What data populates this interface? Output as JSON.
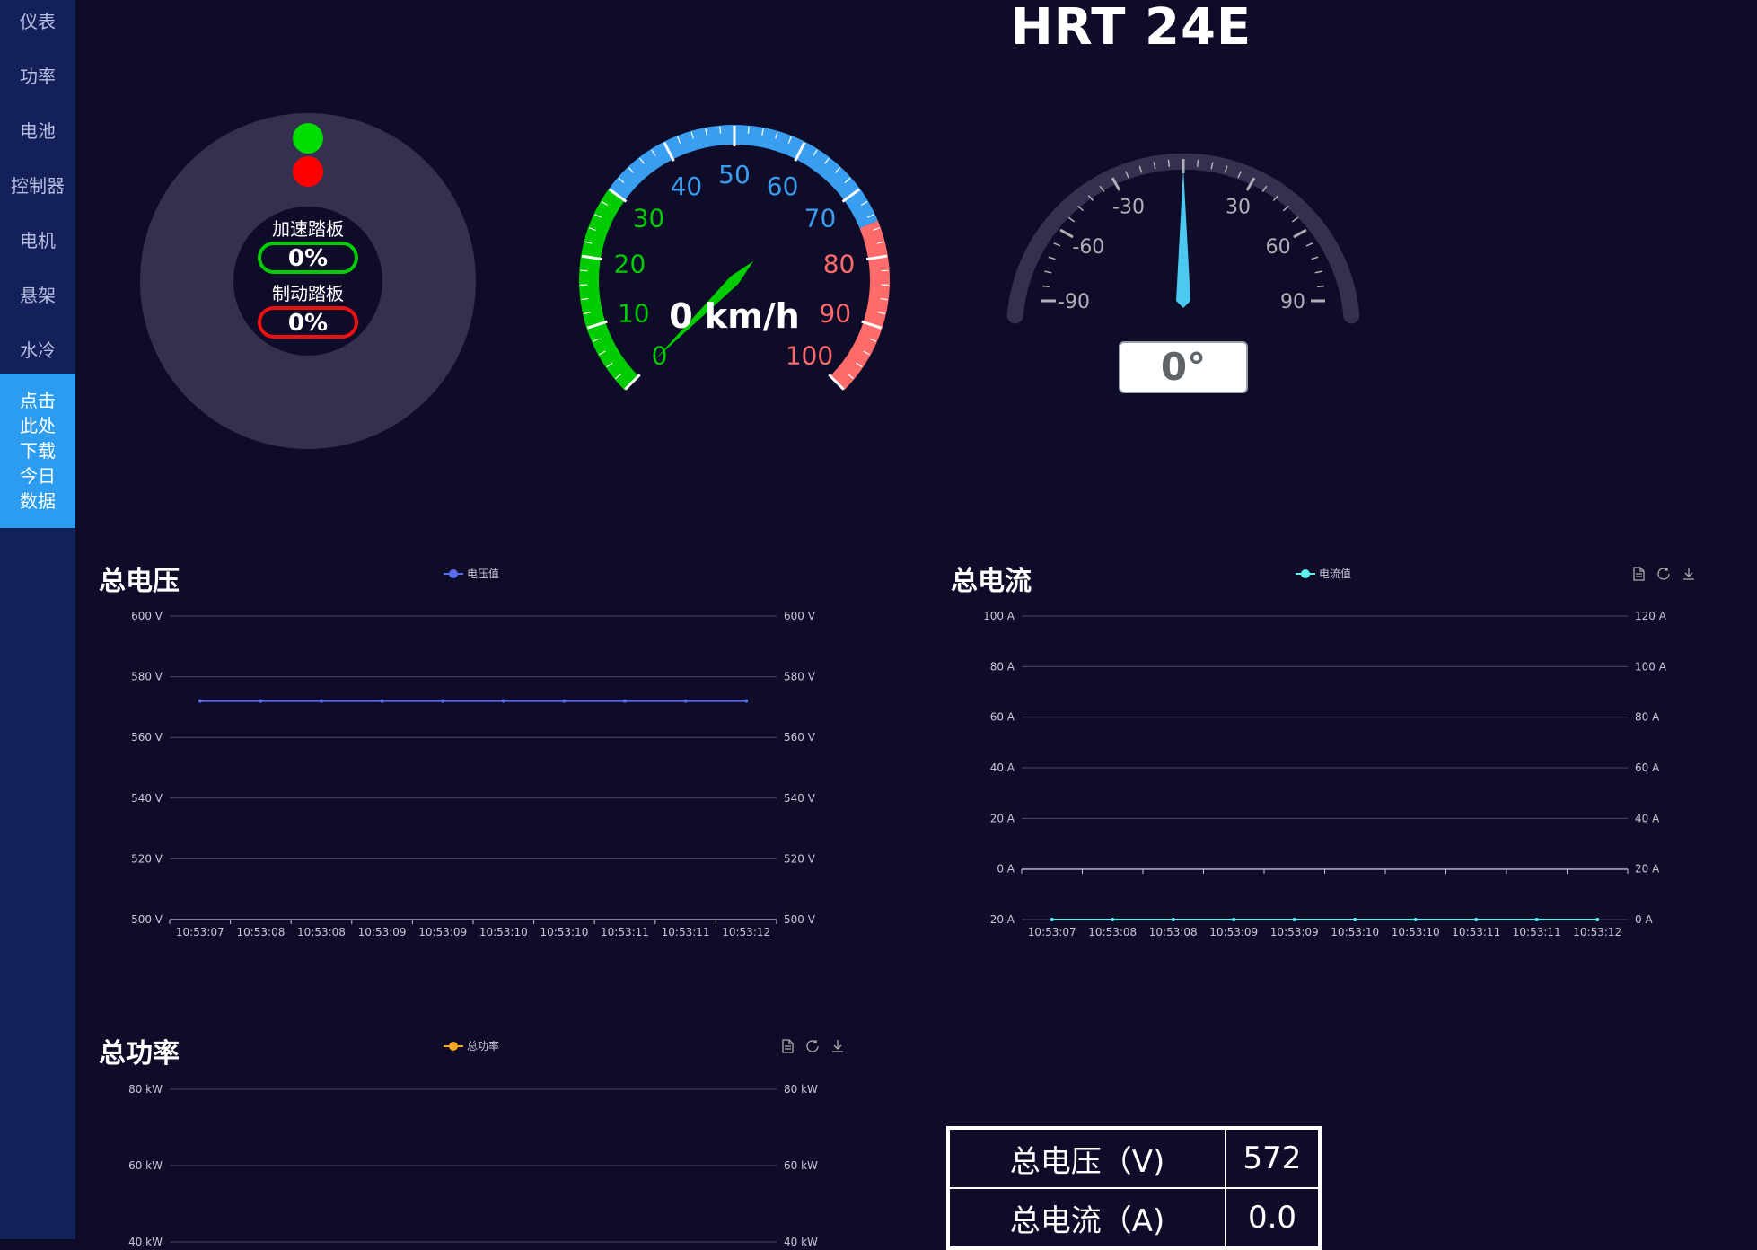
{
  "app_title": "HRT 24E",
  "sidebar": {
    "items": [
      {
        "label": "仪表"
      },
      {
        "label": "功率"
      },
      {
        "label": "电池"
      },
      {
        "label": "控制器"
      },
      {
        "label": "电机"
      },
      {
        "label": "悬架"
      },
      {
        "label": "水冷"
      }
    ],
    "download_lines": [
      "点击",
      "此处",
      "下载",
      "今日",
      "数据"
    ]
  },
  "pedals": {
    "accel_label": "加速踏板",
    "accel_value": "0%",
    "brake_label": "制动踏板",
    "brake_value": "0%",
    "accel_color": "#00cc00",
    "brake_color": "#ee1111"
  },
  "speedometer": {
    "value": 0,
    "unit": "km/h",
    "display": "0 km/h",
    "ticks": [
      "0",
      "10",
      "20",
      "30",
      "40",
      "50",
      "60",
      "70",
      "80",
      "90",
      "100"
    ],
    "zones": [
      {
        "from": 0,
        "to": 30,
        "color": "#00cc00"
      },
      {
        "from": 30,
        "to": 75,
        "color": "#3a9ef0"
      },
      {
        "from": 75,
        "to": 100,
        "color": "#ff6b6b"
      }
    ]
  },
  "steering": {
    "value_deg": 0,
    "display": "0°",
    "ticks": [
      "-90",
      "-60",
      "-30",
      "30",
      "60",
      "90"
    ]
  },
  "chart_data": [
    {
      "title": "总电压",
      "type": "line",
      "legend": "电压值",
      "color": "#5b6bee",
      "x": [
        "10:53:07",
        "10:53:08",
        "10:53:08",
        "10:53:09",
        "10:53:09",
        "10:53:10",
        "10:53:10",
        "10:53:11",
        "10:53:11",
        "10:53:12"
      ],
      "y": [
        572,
        572,
        572,
        572,
        572,
        572,
        572,
        572,
        572,
        572
      ],
      "ylim": [
        500,
        600
      ],
      "yticks": [
        "600 V",
        "580 V",
        "560 V",
        "540 V",
        "520 V",
        "500 V"
      ],
      "ylim_right": [
        500,
        600
      ],
      "yticks_right": [
        "600 V",
        "580 V",
        "560 V",
        "540 V",
        "520 V",
        "500 V"
      ],
      "grid": true
    },
    {
      "title": "总电流",
      "type": "line",
      "legend": "电流值",
      "color": "#5ff0f0",
      "x": [
        "10:53:07",
        "10:53:08",
        "10:53:08",
        "10:53:09",
        "10:53:09",
        "10:53:10",
        "10:53:10",
        "10:53:11",
        "10:53:11",
        "10:53:12"
      ],
      "y": [
        -20,
        -20,
        -20,
        -20,
        -20,
        -20,
        -20,
        -20,
        -20,
        -20
      ],
      "ylim": [
        -20,
        100
      ],
      "yticks": [
        "100 A",
        "80 A",
        "60 A",
        "40 A",
        "20 A",
        "0 A",
        "-20 A"
      ],
      "ylim_right": [
        0,
        120
      ],
      "yticks_right": [
        "120 A",
        "100 A",
        "80 A",
        "60 A",
        "40 A",
        "20 A",
        "0 A"
      ],
      "grid": true
    },
    {
      "title": "总功率",
      "type": "line",
      "legend": "总功率",
      "color": "#f5a623",
      "x": [],
      "y": [],
      "yticks": [
        "80 kW",
        "60 kW",
        "40 kW"
      ],
      "yticks_right": [
        "80 kW",
        "60 kW",
        "40 kW"
      ],
      "grid": true
    }
  ],
  "summary_table": {
    "rows": [
      {
        "label": "总电压（V)",
        "value": "572"
      },
      {
        "label": "总电流（A)",
        "value": "0.0"
      }
    ]
  }
}
